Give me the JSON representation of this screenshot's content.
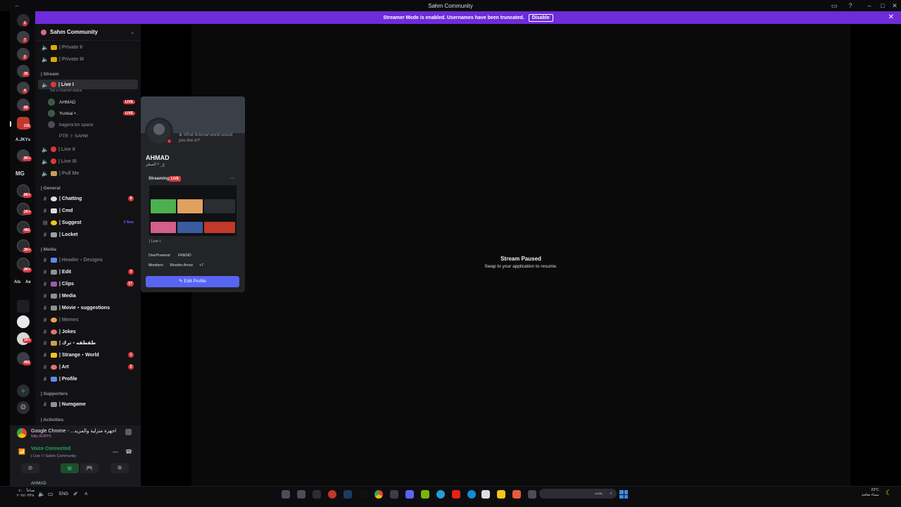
{
  "window": {
    "title": "Sahm Community"
  },
  "banner": {
    "text": "Streamer Mode is enabled. Usernames have been truncated.",
    "button": "Disable"
  },
  "rail": {
    "badges": [
      "1",
      "7",
      "2",
      "30",
      "4",
      "88",
      "215",
      "8K+",
      "8K+",
      "2K+",
      "481",
      "3K+",
      "9K+",
      "1K+",
      "492"
    ],
    "texts": [
      "A.JKYs",
      "MG",
      "Als",
      "Ae"
    ]
  },
  "sidebar": {
    "guild_name": "Sahm Community",
    "channels_top": [
      {
        "name": "| Private II"
      },
      {
        "name": "| Private III"
      }
    ],
    "cat_stream": "| Stream",
    "live_channel": {
      "name": "| Live I",
      "status": "Set a channel status"
    },
    "voice_users": [
      {
        "name": "AHMAD",
        "live": "LIVE"
      },
      {
        "name": "Yunkai • .",
        "live": "LIVE"
      },
      {
        "name": "bagera bn space",
        "live": ""
      },
      {
        "name": "PTR ⊹ SAHM",
        "live": ""
      }
    ],
    "stream_channels": [
      {
        "name": "| Live II"
      },
      {
        "name": "| Live III"
      },
      {
        "name": "| Pull Me"
      }
    ],
    "cat_general": "| General",
    "general_channels": [
      {
        "name": "| Chatting",
        "badge": "8"
      },
      {
        "name": "| Cmd",
        "badge": ""
      },
      {
        "name": "| Suggest",
        "new": "3 New"
      },
      {
        "name": "| Locket",
        "badge": ""
      }
    ],
    "cat_media": "| Media",
    "media_channels": [
      {
        "name": "| Header・Designs",
        "badge": ""
      },
      {
        "name": "| Edit",
        "badge": "3"
      },
      {
        "name": "| Clips",
        "badge": "17"
      },
      {
        "name": "| Media",
        "badge": ""
      },
      {
        "name": "| Movie・suggestions",
        "badge": ""
      },
      {
        "name": "| Memes",
        "badge": ""
      },
      {
        "name": "| Jokes",
        "badge": ""
      },
      {
        "name": "| طقطقه・ترك",
        "badge": ""
      },
      {
        "name": "| Strange・World",
        "badge": "1"
      },
      {
        "name": "| Art",
        "badge": "2"
      },
      {
        "name": "| Profile",
        "badge": ""
      }
    ],
    "cat_supporters": "| Supporters",
    "supporter_channels": [
      {
        "name": "| Numgame"
      }
    ],
    "cat_activities": "| Activities"
  },
  "user_panel": {
    "activity_name": "Google Chrome - ...اجهزة منزلية والمزيد",
    "activity_sub": "Nitty-AOPPS",
    "voice_status": "Voice Connected",
    "voice_where": "| Live I / Sahm Community",
    "username": "AHMAD"
  },
  "stream": {
    "paused_title": "Stream Paused",
    "paused_sub": "Swap to your application to resume."
  },
  "profile": {
    "bubble": "What fictional world would you live in?",
    "name": "AHMAD",
    "tag": "ع_ • الصقر",
    "streaming_label": "Streaming",
    "live_label": "LIVE",
    "channel": "| Live I",
    "roles": [
      "OverPowered",
      "FRIEND",
      "Members",
      "Wooden Arrow",
      "+7"
    ],
    "edit_button": "Edit Profile"
  },
  "taskbar": {
    "clock_time": "صباحاً ٠٤:٠٠",
    "clock_date": "٢٠٢٤/٠٣/٢٨",
    "lang": "ENG",
    "search_placeholder": "بحث",
    "weather_temp": "23°C",
    "weather_desc": "سماء صافية"
  },
  "colors": {
    "accent": "#5865f2",
    "banner": "#6e2bd9",
    "live_red": "#da373c",
    "voice_green": "#23a55a"
  }
}
